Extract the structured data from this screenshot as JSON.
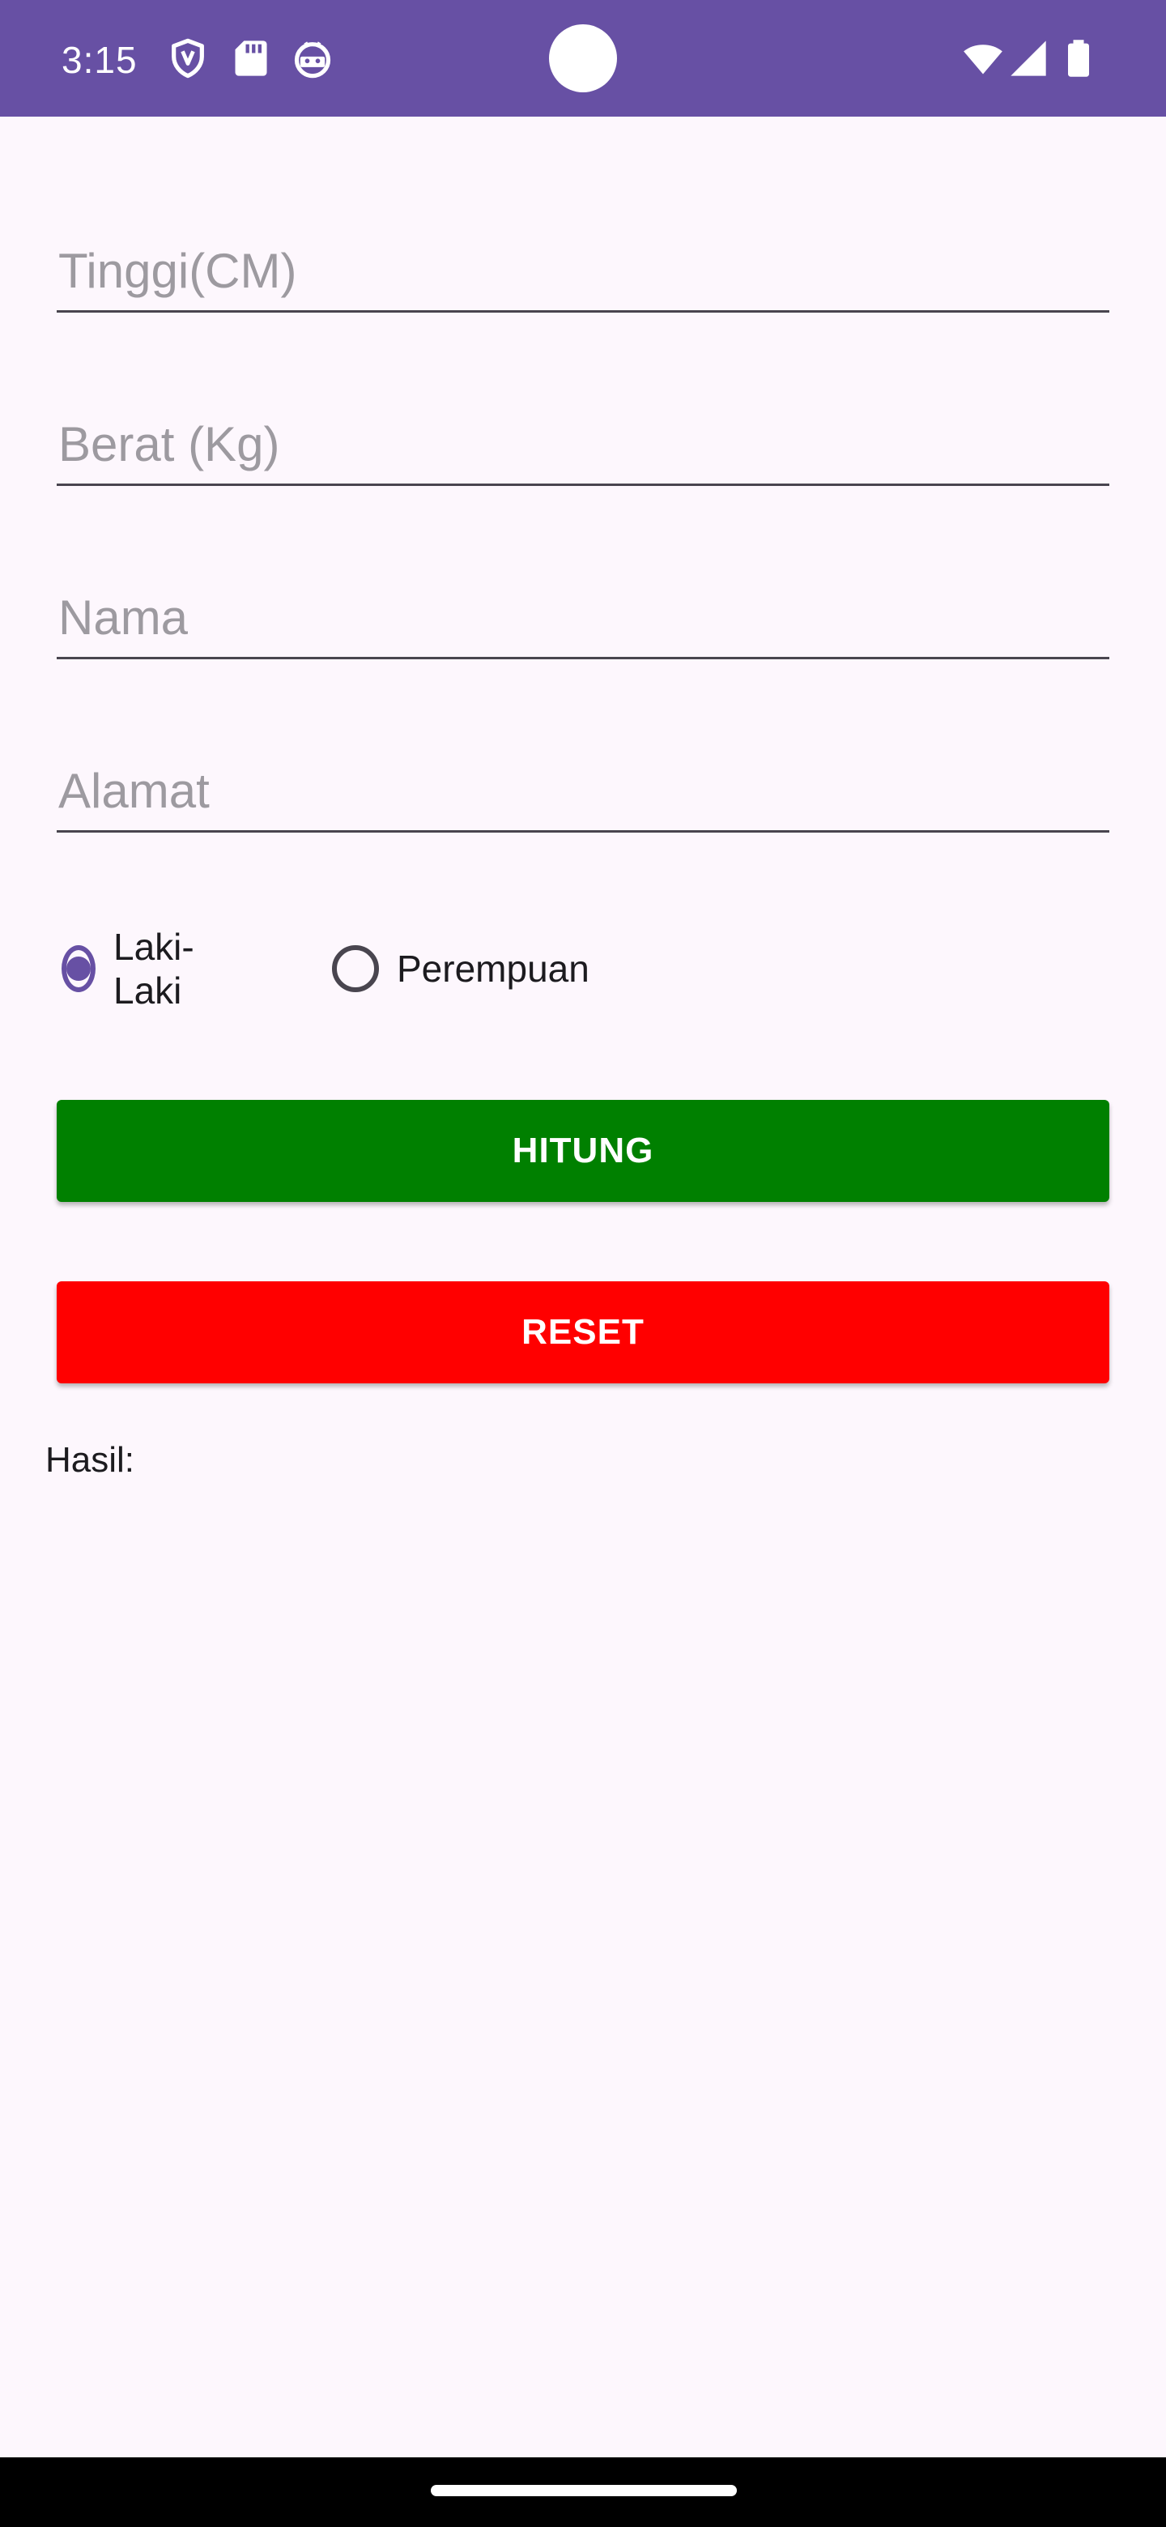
{
  "status_bar": {
    "time": "3:15",
    "background": "#6750a4",
    "left_icons": [
      "vpn-shield-icon",
      "sd-card-icon",
      "android-debug-icon"
    ],
    "right_icons": [
      "wifi-icon",
      "cellular-signal-icon",
      "battery-icon"
    ]
  },
  "form": {
    "height_field": {
      "placeholder": "Tinggi(CM)",
      "value": ""
    },
    "weight_field": {
      "placeholder": "Berat (Kg)",
      "value": ""
    },
    "name_field": {
      "placeholder": "Nama",
      "value": ""
    },
    "address_field": {
      "placeholder": "Alamat",
      "value": ""
    },
    "gender": {
      "selected": "Laki-Laki",
      "options": [
        {
          "label": "Laki-Laki",
          "checked": true
        },
        {
          "label": "Perempuan",
          "checked": false
        }
      ]
    }
  },
  "buttons": {
    "calculate_label": "HITUNG",
    "calculate_color": "#008000",
    "reset_label": "RESET",
    "reset_color": "#ff0000"
  },
  "result": {
    "label": "Hasil:"
  },
  "colors": {
    "accent": "#6750a4",
    "background": "#fdf7fd"
  }
}
